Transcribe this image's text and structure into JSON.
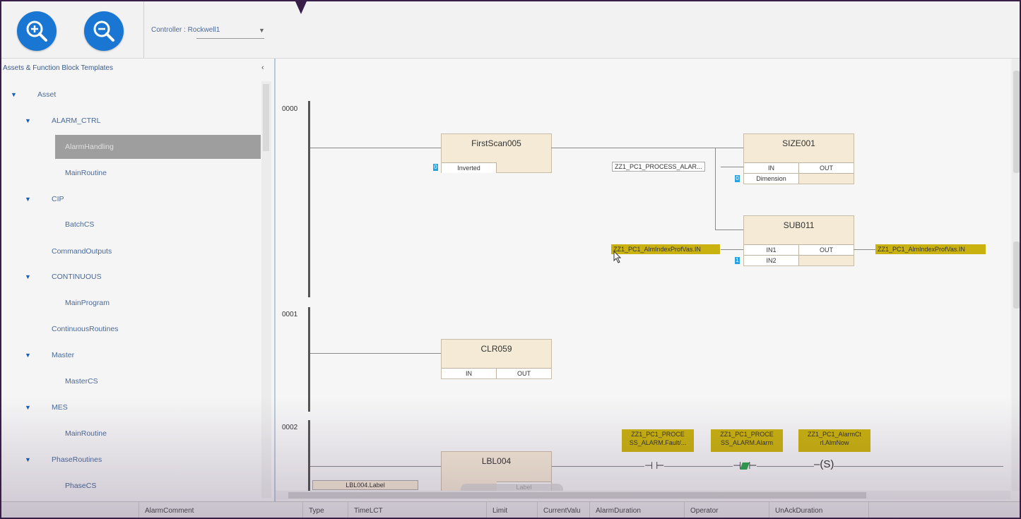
{
  "toolbar": {
    "zoom_in_icon": "zoom-in-icon",
    "zoom_out_icon": "zoom-out-icon",
    "controller_label": "Controller : Rockwell1"
  },
  "sidebar": {
    "title": "Assets & Function Block Templates",
    "collapse_glyph": "‹",
    "tree": [
      {
        "label": "Asset",
        "expanded": true
      },
      {
        "label": "ALARM_CTRL",
        "expanded": true
      },
      {
        "label": "AlarmHandling",
        "selected": true
      },
      {
        "label": "MainRoutine"
      },
      {
        "label": "CIP",
        "expanded": true
      },
      {
        "label": "BatchCS"
      },
      {
        "label": "CommandOutputs"
      },
      {
        "label": "CONTINUOUS",
        "expanded": true
      },
      {
        "label": "MainProgram"
      },
      {
        "label": "ContinuousRoutines"
      },
      {
        "label": "Master",
        "expanded": true
      },
      {
        "label": "MasterCS"
      },
      {
        "label": "MES",
        "expanded": true
      },
      {
        "label": "MainRoutine"
      },
      {
        "label": "PhaseRoutines",
        "expanded": true
      },
      {
        "label": "PhaseCS"
      }
    ]
  },
  "diagram": {
    "rungs": [
      "0000",
      "0001",
      "0002"
    ],
    "blocks": {
      "firstscan": {
        "title": "FirstScan005",
        "pin_in": "Inverted",
        "badge": "0"
      },
      "size": {
        "title": "SIZE001",
        "pin_in": "IN",
        "pin_out": "OUT",
        "pin_in2": "Dimension",
        "badge": "0"
      },
      "sub": {
        "title": "SUB011",
        "pin_in": "IN1",
        "pin_out": "OUT",
        "pin_in2": "IN2",
        "badge": "1"
      },
      "clr": {
        "title": "CLR059",
        "pin_in": "IN",
        "pin_out": "OUT"
      },
      "lbl": {
        "title": "LBL004",
        "pin_in": "LBL004.Label",
        "pin_out": "Label"
      }
    },
    "tags": {
      "process_alarm": "ZZ1_PC1_PROCESS_ALAR...",
      "alm_index_in": "ZZ1_PC1_AlmIndexProfVas.IN",
      "alm_index_out": "ZZ1_PC1_AlmIndexProfVas.IN",
      "coil1": "ZZ1_PC1_PROCE SS_ALARM.Fault/...",
      "coil2": "ZZ1_PC1_PROCE SS_ALARM.Alarm",
      "coil3": "ZZ1_PC1_AlarmCt rl.AlmNow"
    },
    "coil_set_label": "S"
  },
  "grid": {
    "columns": [
      "AlarmComment",
      "Type",
      "TimeLCT",
      "Limit",
      "CurrentValu",
      "AlarmDuration",
      "Operator",
      "UnAckDuration"
    ]
  }
}
